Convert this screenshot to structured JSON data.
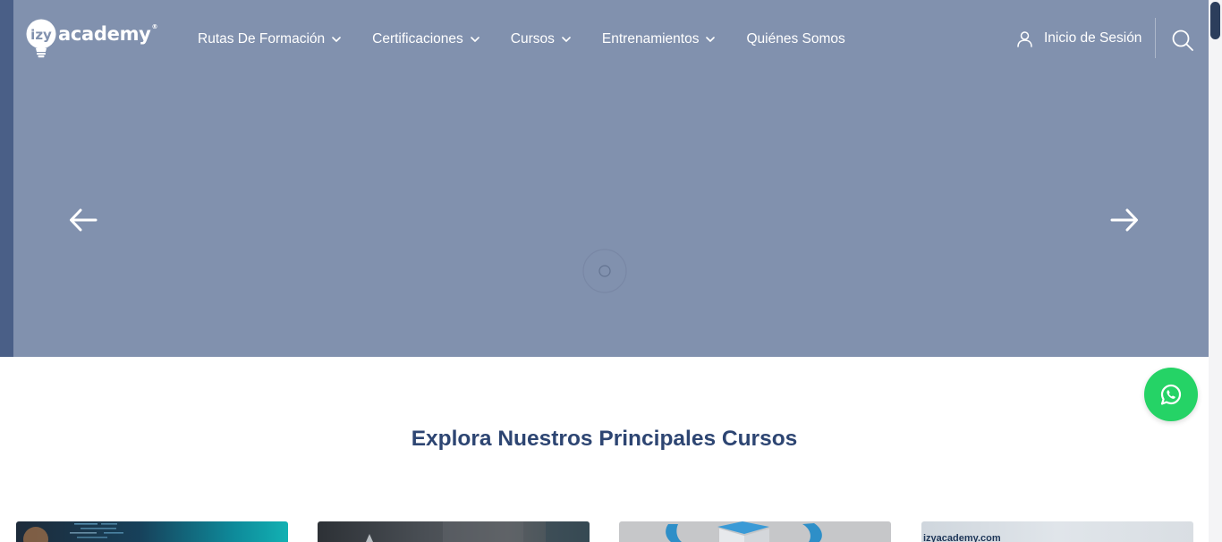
{
  "header": {
    "logo": {
      "text": "academy",
      "registered": "®",
      "bulb_text": "izy"
    },
    "nav": [
      {
        "label": "Rutas De Formación",
        "dropdown": true
      },
      {
        "label": "Certificaciones",
        "dropdown": true
      },
      {
        "label": "Cursos",
        "dropdown": true
      },
      {
        "label": "Entrenamientos",
        "dropdown": true
      },
      {
        "label": "Quiénes Somos",
        "dropdown": false
      }
    ],
    "login_label": "Inicio de Sesión",
    "icons": {
      "user": "user-icon",
      "search": "search-icon",
      "chevron": "chevron-down-icon"
    }
  },
  "hero": {
    "prev_icon": "arrow-left-icon",
    "next_icon": "arrow-right-icon",
    "loading_icon": "spinner-icon",
    "overlay_color": "#8191ae"
  },
  "whatsapp": {
    "icon": "whatsapp-icon",
    "color": "#25d366"
  },
  "courses": {
    "title": "Explora Nuestros Principales Cursos",
    "cards": [
      {
        "caption": ""
      },
      {
        "caption": ""
      },
      {
        "caption": ""
      },
      {
        "caption": "izyacademy.com"
      }
    ]
  },
  "colors": {
    "brand_navy": "#2d4572",
    "accent_green": "#25d366"
  }
}
